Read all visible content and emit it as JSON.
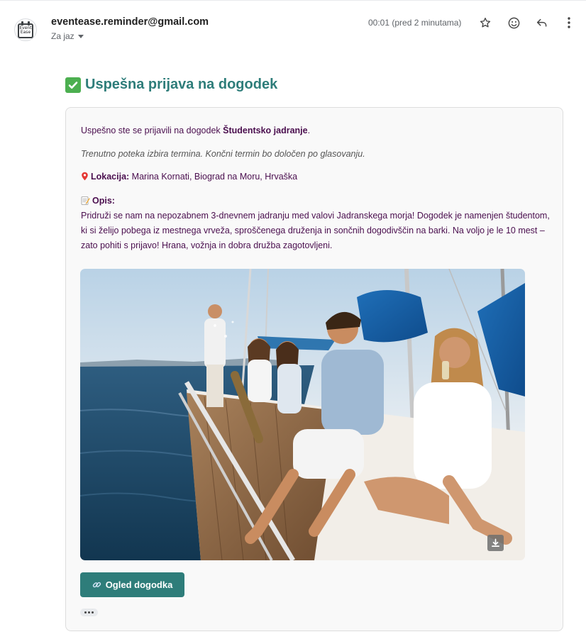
{
  "header": {
    "avatar_text": "Event Ease",
    "sender": "eventease.reminder@gmail.com",
    "recipient": "Za jaz",
    "time": "00:01 (pred 2 minutama)",
    "icons": [
      "star-icon",
      "emoji-icon",
      "reply-icon",
      "more-vert-icon"
    ]
  },
  "email": {
    "title": "Uspešna prijava na dogodek",
    "intro_prefix": "Uspešno ste se prijavili na dogodek ",
    "event_name": "Študentsko jadranje",
    "intro_suffix": ".",
    "notice": "Trenutno poteka izbira termina. Končni termin bo določen po glasovanju.",
    "location_label": "Lokacija:",
    "location_value": " Marina Kornati, Biograd na Moru, Hrvaška",
    "description_label": "Opis:",
    "description": "Pridruži se nam na nepozabnem 3-dnevnem jadranju med valovi Jadranskega morja! Dogodek je namenjen študentom, ki si želijo pobega iz mestnega vrveža, sproščenega druženja in sončnih dogodivščin na barki. Na voljo je le 10 mest – zato pohiti s prijavo! Hrana, vožnja in dobra družba zagotovljeni.",
    "button_label": "Ogled dogodka"
  },
  "colors": {
    "title": "#2e7d7a",
    "text": "#4a0e4e",
    "button": "#2e7d7a"
  }
}
